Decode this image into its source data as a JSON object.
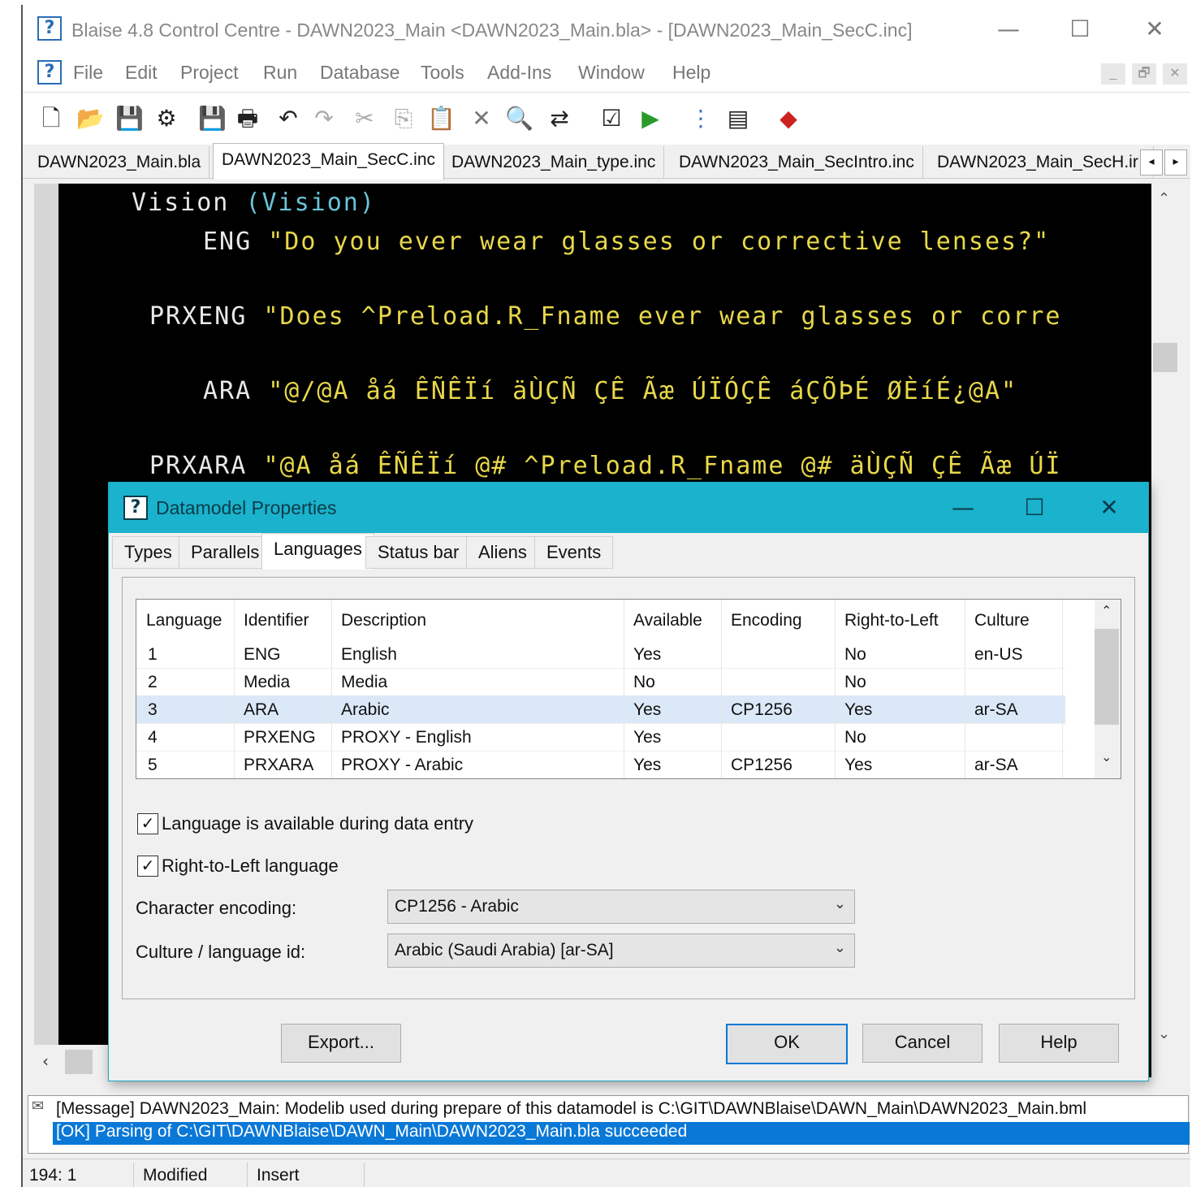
{
  "window": {
    "title": "Blaise 4.8 Control Centre - DAWN2023_Main <DAWN2023_Main.bla> - [DAWN2023_Main_SecC.inc]",
    "controls": {
      "minimize": "—",
      "maximize": "☐",
      "close": "✕"
    }
  },
  "menu": {
    "items": [
      "File",
      "Edit",
      "Project",
      "Run",
      "Database",
      "Tools",
      "Add-Ins",
      "Window",
      "Help"
    ],
    "mdi_controls": {
      "minimize": "_",
      "restore": "🗗",
      "close": "✕"
    }
  },
  "toolbar": {
    "buttons": [
      {
        "name": "new-icon",
        "glyph": "🗋"
      },
      {
        "name": "open-icon",
        "glyph": "📂"
      },
      {
        "name": "save-all-icon",
        "glyph": "💾"
      },
      {
        "name": "prepare-icon",
        "glyph": "⚙"
      },
      {
        "name": "save-icon",
        "glyph": "💾"
      },
      {
        "name": "print-icon",
        "glyph": "🖶"
      },
      {
        "name": "undo-icon",
        "glyph": "↶"
      },
      {
        "name": "redo-icon",
        "glyph": "↷"
      },
      {
        "name": "cut-icon",
        "glyph": "✂"
      },
      {
        "name": "copy-icon",
        "glyph": "⎘"
      },
      {
        "name": "paste-icon",
        "glyph": "📋"
      },
      {
        "name": "delete-icon",
        "glyph": "✕"
      },
      {
        "name": "find-icon",
        "glyph": "🔍"
      },
      {
        "name": "replace-icon",
        "glyph": "⇄"
      },
      {
        "name": "check-icon",
        "glyph": "☑"
      },
      {
        "name": "run-icon",
        "glyph": "▶"
      },
      {
        "name": "structure-icon",
        "glyph": "⋮"
      },
      {
        "name": "pages-icon",
        "glyph": "▤"
      },
      {
        "name": "tag-icon",
        "glyph": "◆"
      }
    ]
  },
  "file_tabs": [
    {
      "label": "DAWN2023_Main.bla",
      "active": false
    },
    {
      "label": "DAWN2023_Main_SecC.inc",
      "active": true
    },
    {
      "label": "DAWN2023_Main_type.inc",
      "active": false
    },
    {
      "label": "DAWN2023_Main_SecIntro.inc",
      "active": false
    },
    {
      "label": "DAWN2023_Main_SecH.ir",
      "active": false
    }
  ],
  "editor": {
    "lines": [
      {
        "kw": "Vision ",
        "par": "(Vision)",
        "str": ""
      },
      {
        "kw": "ENG ",
        "par": "",
        "str": "\"Do you ever wear glasses or corrective lenses?\""
      },
      {
        "kw": "PRXENG ",
        "par": "",
        "str": "\"Does ^Preload.R_Fname ever wear glasses or corre"
      },
      {
        "kw": "ARA ",
        "par": "",
        "str": "\"@/@A åá ÊÑÊÏí äÙÇÑ ÇÊ Ãæ ÚÏÓÇÊ áÇÕÞÉ ØÈíÉ¿@A\""
      },
      {
        "kw": "PRXARA ",
        "par": "",
        "str": "\"@A åá ÊÑÊÏí @# ^Preload.R_Fname @# äÙÇÑ ÇÊ Ãæ ÚÏ"
      }
    ]
  },
  "dialog": {
    "title": "Datamodel Properties",
    "controls": {
      "minimize": "—",
      "maximize": "☐",
      "close": "✕"
    },
    "tabs": [
      "Types",
      "Parallels",
      "Languages",
      "Status bar",
      "Aliens",
      "Events"
    ],
    "active_tab": "Languages",
    "table": {
      "columns": [
        "Language",
        "Identifier",
        "Description",
        "Available",
        "Encoding",
        "Right-to-Left",
        "Culture"
      ],
      "rows": [
        [
          "1",
          "ENG",
          "English",
          "Yes",
          "",
          "No",
          "en-US"
        ],
        [
          "2",
          "Media",
          "Media",
          "No",
          "",
          "No",
          ""
        ],
        [
          "3",
          "ARA",
          "Arabic",
          "Yes",
          "CP1256",
          "Yes",
          "ar-SA"
        ],
        [
          "4",
          "PRXENG",
          "PROXY - English",
          "Yes",
          "",
          "No",
          ""
        ],
        [
          "5",
          "PRXARA",
          "PROXY - Arabic",
          "Yes",
          "CP1256",
          "Yes",
          "ar-SA"
        ]
      ],
      "selected_row": 3
    },
    "checkboxes": {
      "available": {
        "label": "Language is available during data entry",
        "checked": true
      },
      "rtl": {
        "label": "Right-to-Left language",
        "checked": true
      }
    },
    "encoding": {
      "label": "Character encoding:",
      "value": "CP1256  - Arabic"
    },
    "culture": {
      "label": "Culture / language id:",
      "value": "Arabic (Saudi Arabia) [ar-SA]"
    },
    "buttons": {
      "export": "Export...",
      "ok": "OK",
      "cancel": "Cancel",
      "help": "Help"
    }
  },
  "messages": [
    {
      "text": "[Message] DAWN2023_Main: Modelib used during prepare of this datamodel is C:\\GIT\\DAWNBlaise\\DAWN_Main\\DAWN2023_Main.bml",
      "selected": false
    },
    {
      "text": "[OK] Parsing of C:\\GIT\\DAWNBlaise\\DAWN_Main\\DAWN2023_Main.bla succeeded",
      "selected": true
    }
  ],
  "statusbar": {
    "position": "194: 1",
    "modified": "Modified",
    "mode": "Insert"
  },
  "colors": {
    "accent": "#1ab2cc",
    "selection": "#0a78d7",
    "code_string": "#e8d84a",
    "code_keyword": "#e8e8e8"
  }
}
